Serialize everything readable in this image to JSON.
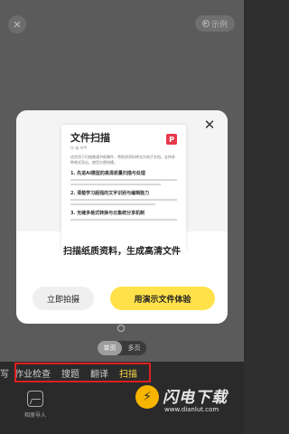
{
  "header": {
    "close_glyph": "✕",
    "example_label": "示例",
    "example_icon": "play-circle-icon"
  },
  "modal": {
    "close_glyph": "✕",
    "document": {
      "title": "文件扫描",
      "meta": "作 者 APP",
      "logo_glyph": "P",
      "intro": "适合用于扫描普通书纸稿件，将纸质资料转化为电子文档，支持多种格式导出，使用方便快捷。",
      "headings": [
        "1. 先进AI模型的高清质量扫描与处理",
        "2. 清楚学习超强的文字识别与编辑能力",
        "3. 无缝多格式转换与云集统分享机制"
      ]
    },
    "caption": "扫描纸质资料，生成高清文件",
    "secondary_button": "立即拍摄",
    "primary_button": "用演示文件体验"
  },
  "page_mode": {
    "options": [
      "单页",
      "多页"
    ],
    "active_index": 0
  },
  "modes": {
    "items": [
      "写",
      "作业检查",
      "搜题",
      "翻译",
      "扫描"
    ],
    "active_index": 4,
    "highlight_color": "#e01e1e",
    "active_color": "#ffd84a"
  },
  "import": {
    "label": "相册导入",
    "icon": "image-icon"
  },
  "watermark": {
    "logo_glyph": "⚡",
    "text": "闪电下载",
    "url": "www.dianlut.com"
  }
}
